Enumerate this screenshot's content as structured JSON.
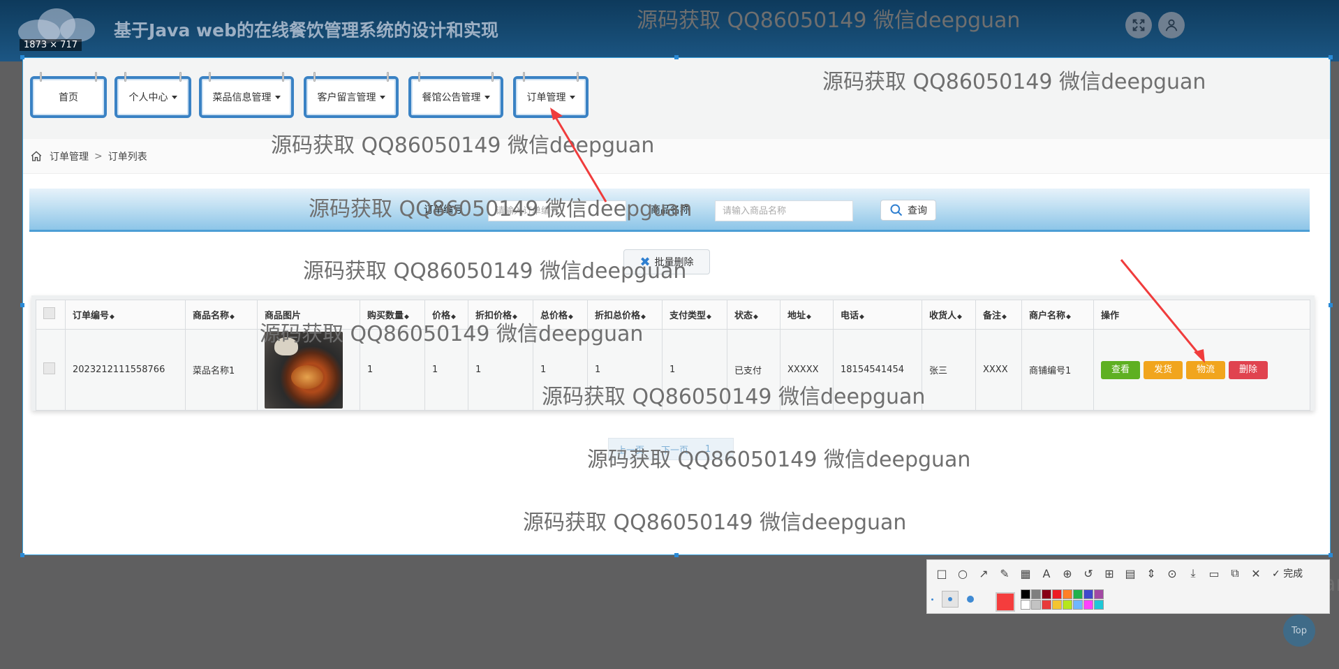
{
  "header": {
    "title": "基于Java web的在线餐饮管理系统的设计和实现",
    "dimension_label": "1873 × 717",
    "fullscreen_icon": "expand-icon",
    "user_icon": "user-icon"
  },
  "nav": {
    "items": [
      {
        "label": "首页",
        "dropdown": false
      },
      {
        "label": "个人中心",
        "dropdown": true
      },
      {
        "label": "菜品信息管理",
        "dropdown": true
      },
      {
        "label": "客户留言管理",
        "dropdown": true
      },
      {
        "label": "餐馆公告管理",
        "dropdown": true
      },
      {
        "label": "订单管理",
        "dropdown": true
      }
    ]
  },
  "breadcrumb": {
    "home_icon": "home-icon",
    "parent": "订单管理",
    "separator": ">",
    "current": "订单列表"
  },
  "search": {
    "order_no_label": "订单编号",
    "order_no_placeholder": "请输入订单编号",
    "product_name_label": "商品名称",
    "product_name_placeholder": "请输入商品名称",
    "query_button": "查询"
  },
  "batch_delete_button": "批量删除",
  "table": {
    "columns": [
      "订单编号",
      "商品名称",
      "商品图片",
      "购买数量",
      "价格",
      "折扣价格",
      "总价格",
      "折扣总价格",
      "支付类型",
      "状态",
      "地址",
      "电话",
      "收货人",
      "备注",
      "商户名称",
      "操作"
    ],
    "rows": [
      {
        "order_no": "2023212111558766",
        "product_name": "菜品名称1",
        "quantity": "1",
        "price": "1",
        "discount_price": "1",
        "total_price": "1",
        "discount_total": "1",
        "pay_type": "1",
        "status": "已支付",
        "address": "XXXXX",
        "phone": "18154541454",
        "receiver": "张三",
        "remark": "XXXX",
        "merchant": "商铺编号1"
      }
    ],
    "actions": {
      "view": "查看",
      "ship": "发货",
      "logistics": "物流",
      "delete": "删除"
    }
  },
  "pager": {
    "prev": "上一页",
    "next": "下一页",
    "page": "1"
  },
  "watermark": "源码获取 QQ86050149 微信deepguan",
  "snip_toolbar": {
    "done": "完成",
    "selected_color": "#f43d3d",
    "palette": [
      "#000000",
      "#7f7f7f",
      "#880015",
      "#ed1c24",
      "#ff7f27",
      "#22b14c",
      "#3f48cc",
      "#a349a4",
      "#ffffff",
      "#c3c3c3",
      "#e83a3a",
      "#f4c430",
      "#b5e61d",
      "#6fb6ff",
      "#ff40ff",
      "#1fc8d8"
    ]
  },
  "top_button": "Top",
  "colors": {
    "header": "#164b73",
    "accent": "#3a82c4",
    "view": "#5eb022",
    "ship": "#f1a51d",
    "delete": "#e0434f"
  }
}
